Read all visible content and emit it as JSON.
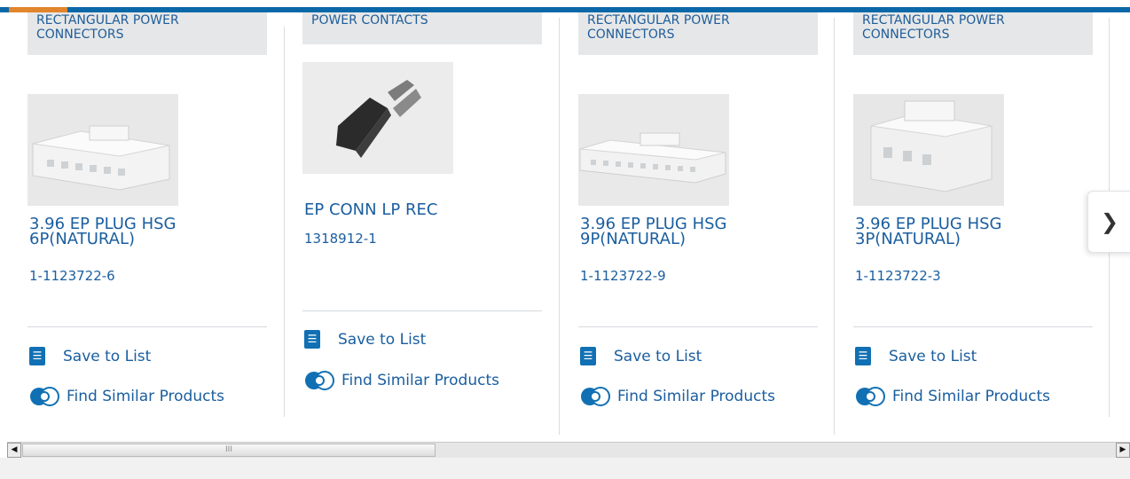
{
  "cards": [
    {
      "category": "RECTANGULAR POWER CONNECTORS",
      "title": "3.96 EP PLUG HSG 6P(NATURAL)",
      "part_number": "1-1123722-6",
      "image_alt": "white rectangular plug housing",
      "save_label": "Save to List",
      "similar_label": "Find Similar Products"
    },
    {
      "category": "POWER CONTACTS",
      "title": "EP CONN LP REC",
      "part_number": "1318912-1",
      "image_alt": "crimp contact",
      "save_label": "Save to List",
      "similar_label": "Find Similar Products"
    },
    {
      "category": "RECTANGULAR POWER CONNECTORS",
      "title": "3.96 EP PLUG HSG 9P(NATURAL)",
      "part_number": "1-1123722-9",
      "image_alt": "white rectangular plug housing",
      "save_label": "Save to List",
      "similar_label": "Find Similar Products"
    },
    {
      "category": "RECTANGULAR POWER CONNECTORS",
      "title": "3.96 EP PLUG HSG 3P(NATURAL)",
      "part_number": "1-1123722-3",
      "image_alt": "white rectangular plug housing",
      "save_label": "Save to List",
      "similar_label": "Find Similar Products"
    }
  ],
  "carousel": {
    "next_icon": "chevron-right-icon"
  },
  "scrollbar": {
    "thumb_grip": "III",
    "left_arrow": "◀",
    "right_arrow": "▶"
  },
  "colors": {
    "accent": "#0b68a8",
    "tab_accent": "#e2852c",
    "link": "#1a5e9f",
    "category_bg": "#e6e7e8"
  }
}
